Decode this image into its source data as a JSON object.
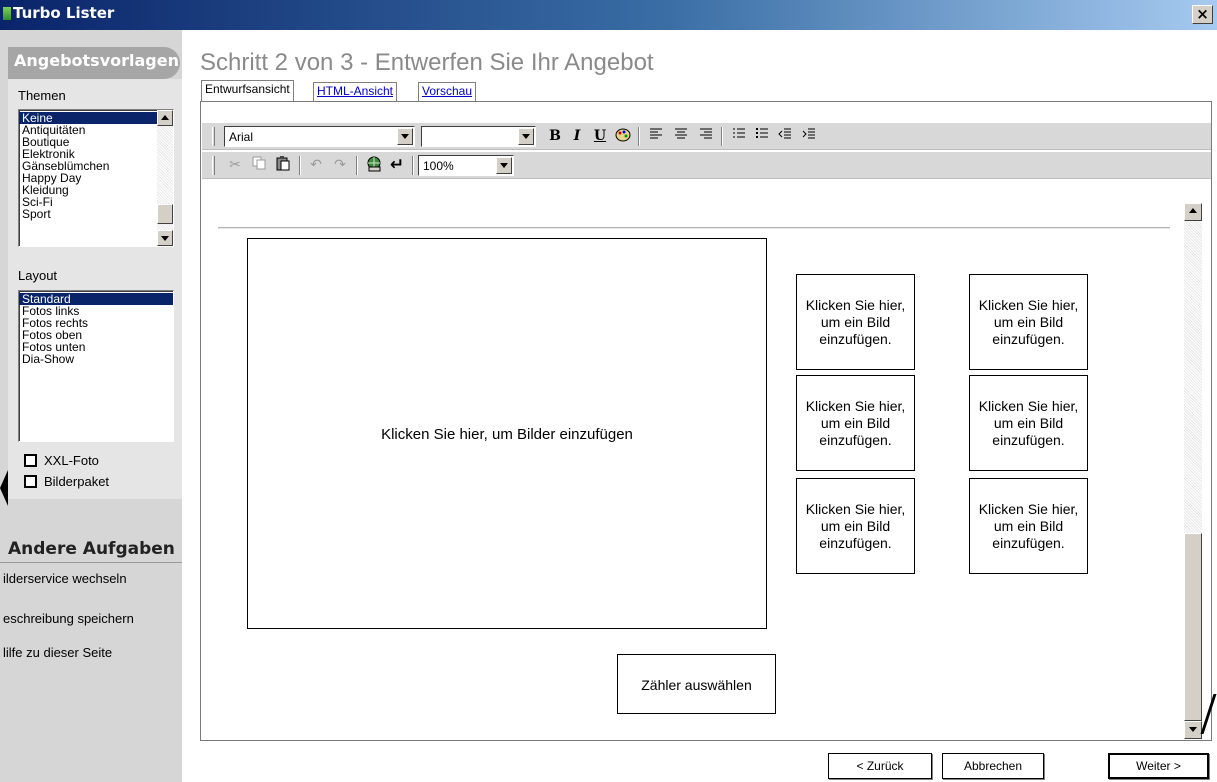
{
  "window": {
    "title": "Turbo Lister",
    "close_label": "×"
  },
  "sidebar": {
    "header": "Angebotsvorlagen",
    "themes_label": "Themen",
    "themes": [
      "Keine",
      "Antiquitäten",
      "Boutique",
      "Elektronik",
      "Gänseblümchen",
      "Happy Day",
      "Kleidung",
      "Sci-Fi",
      "Sport"
    ],
    "themes_selected": "Keine",
    "layout_label": "Layout",
    "layouts": [
      "Standard",
      "Fotos links",
      "Fotos rechts",
      "Fotos oben",
      "Fotos unten",
      "Dia-Show"
    ],
    "layout_selected": "Standard",
    "xxl_foto": {
      "label": "XXL-Foto",
      "checked": false
    },
    "bilderpaket": {
      "label": "Bilderpaket",
      "checked": false
    },
    "tasks_title": "Andere Aufgaben",
    "tasks": [
      "ilderservice wechseln",
      "eschreibung speichern",
      "lilfe zu dieser Seite"
    ]
  },
  "main": {
    "title": "Schritt 2 von 3 - Entwerfen Sie Ihr Angebot",
    "tabs": [
      {
        "label": "Entwurfsansicht",
        "active": true
      },
      {
        "label": "HTML-Ansicht",
        "active": false
      },
      {
        "label": "Vorschau",
        "active": false
      }
    ]
  },
  "toolbar": {
    "font": "Arial",
    "font_size": "",
    "zoom": "100%",
    "bold": "B",
    "italic": "I",
    "underline": "U"
  },
  "canvas": {
    "big_photo": "Klicken Sie hier, um Bilder einzufügen",
    "thumb_text": "Klicken Sie hier, um ein Bild einzufügen.",
    "thumbs": [
      "Klicken Sie hier, um ein Bild einzufügen.",
      "Klicken Sie hier, um ein Bild einzufügen.",
      "Klicken Sie hier, um ein Bild einzufügen.",
      "Klicken Sie hier, um ein Bild einzufügen.",
      "Klicken Sie hier, um ein Bild einzufügen.",
      "Klicken Sie hier, um ein Bild einzufügen."
    ],
    "counter": "Zähler auswählen"
  },
  "buttons": {
    "back": "< Zurück",
    "cancel": "Abbrechen",
    "next": "Weiter >"
  }
}
